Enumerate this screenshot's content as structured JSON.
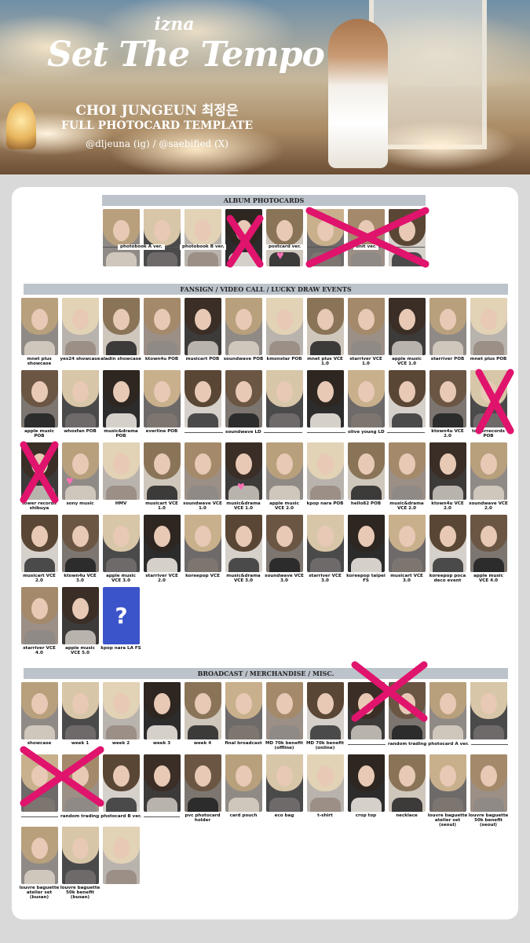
{
  "header": {
    "logo_small": "izna",
    "logo_large": "Set The Tempo",
    "member": "CHOI JUNGEUN 최정은",
    "subtitle": "FULL PHOTOCARD TEMPLATE",
    "credits": "@dljeuna (ig) / @saebified (X)"
  },
  "sections": {
    "album": "ALBUM PHOTOCARDS",
    "fansign": "FANSIGN / VIDEO CALL / LUCKY DRAW EVENTS",
    "broadcast": "BROADCAST / MERCHANDISE / MISC."
  },
  "album_groups": [
    "photobook A ver.",
    "photobook B ver.",
    "postcard ver.",
    "unit ver."
  ],
  "fansign_labels": [
    "mnet plus showcase",
    "yes24 showcase",
    "aladin showcase",
    "ktown4u POB",
    "musicart POB",
    "soundwave POB",
    "kmonstar POB",
    "mnet plus VCE 1.0",
    "starriver VCE 1.0",
    "apple music VCE 1.0",
    "starriver POB",
    "mnet plus POB",
    "apple music POB",
    "whosfan POB",
    "music&drama POB",
    "everline POB",
    "soundwave LD",
    "olive young LD",
    "ktown4u VCE 2.0",
    "towerrecords POB",
    "tower records shibuya",
    "sony music",
    "HMV",
    "musicart VCE 1.0",
    "soundwave VCE 1.0",
    "music&drama VCE 1.0",
    "apple music VCE 2.0",
    "kpop nara POB",
    "hello82 POB",
    "music&drama VCE 2.0",
    "ktown4u VCE 2.0",
    "soundwave VCE 2.0",
    "musicart VCE 2.0",
    "ktown4u VCE 3.0",
    "apple music VCE 3.0",
    "starriver VCE 2.0",
    "koreepop VCE",
    "music&drama VCE 3.0",
    "soundwave VCE 3.0",
    "starriver VCE 3.0",
    "koreepop taipei FS",
    "musicart VCE 3.0",
    "koreepop poca deco event",
    "apple music VCE 4.0",
    "starriver VCE 4.0",
    "apple music VCE 5.0",
    "kpop nara LA FS"
  ],
  "unknown_mark": "?",
  "broadcast_labels": [
    "showcase",
    "week 1",
    "week 2",
    "week 3",
    "week 4",
    "final broadcast",
    "MD 70k benefit (offline)",
    "MD 70k benefit (online)",
    "random trading photocard A ver.",
    "random trading photocard B ver.",
    "pvc photocard holder",
    "card pouch",
    "eco bag",
    "t-shirt",
    "crop top",
    "necklace",
    "louvre baguette atelier set (seoul)",
    "louvre baguette 50k benefit (seoul)",
    "louvre baguette atelier set (busan)",
    "louvre baguette 50k benefit (busan)"
  ],
  "colors": {
    "section_bar": "#bcc3cb",
    "cross_mark": "#e0136d",
    "question_card": "#3c54c9",
    "panel": "#ffffff",
    "background": "#d9d9d9"
  }
}
